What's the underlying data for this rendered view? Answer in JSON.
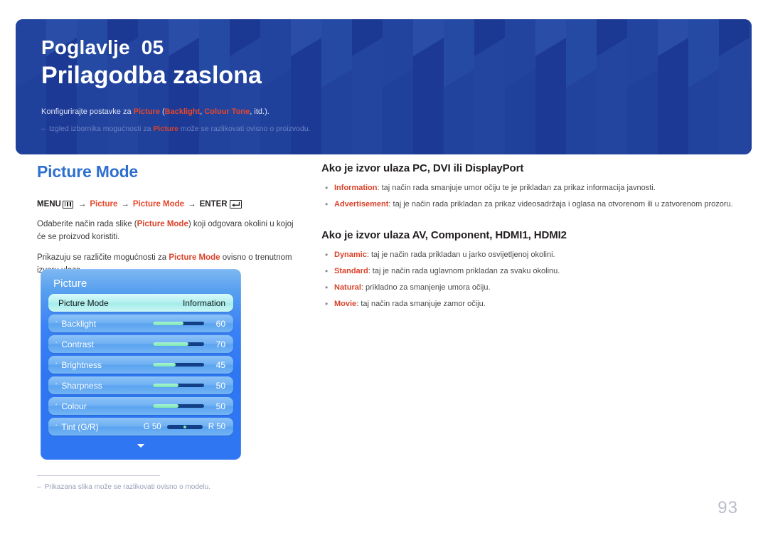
{
  "banner": {
    "chapter_label": "Poglavlje  05",
    "chapter_title": "Prilagodba zaslona",
    "desc_prefix": "Konfigurirajte postavke za ",
    "desc_kw1": "Picture",
    "desc_mid1": " (",
    "desc_kw2": "Backlight",
    "desc_mid2": ", ",
    "desc_kw3": "Colour Tone",
    "desc_suffix": ", itd.).",
    "note_dash": "–",
    "note_prefix": "Izgled izbornika mogućnosti za ",
    "note_kw": "Picture",
    "note_suffix": " može se razlikovati ovisno o proizvodu.",
    "bg_color": "#1f3f9e"
  },
  "left": {
    "section_heading": "Picture Mode",
    "section_heading_color": "#2f6fd0",
    "menu_path": {
      "menu_label": "MENU",
      "menu_icon": "menu-bars-icon",
      "arrow": "→",
      "step1": "Picture",
      "step2": "Picture Mode",
      "enter_label": "ENTER",
      "enter_icon": "enter-key-icon"
    },
    "paragraphs": [
      {
        "pre": "Odaberite način rada slike (",
        "kw": "Picture Mode",
        "post": ") koji odgovara okolini u kojoj će se proizvod koristiti."
      },
      {
        "pre": "Prikazuju se različite mogućnosti za ",
        "kw": "Picture Mode",
        "post": " ovisno o trenutnom izvoru ulaza."
      }
    ],
    "footnote": {
      "dash": "–",
      "text": "Prikazana slika može se razlikovati ovisno o modelu."
    }
  },
  "osd": {
    "title": "Picture",
    "rows": [
      {
        "label": "Picture Mode",
        "value": "Information",
        "type": "selected",
        "bullet": ""
      },
      {
        "label": "Backlight",
        "value": "60",
        "type": "slider",
        "bullet": "·",
        "fill_pct": 60
      },
      {
        "label": "Contrast",
        "value": "70",
        "type": "slider",
        "bullet": "·",
        "fill_pct": 70
      },
      {
        "label": "Brightness",
        "value": "45",
        "type": "slider",
        "bullet": "·",
        "fill_pct": 45
      },
      {
        "label": "Sharpness",
        "value": "50",
        "type": "slider",
        "bullet": "·",
        "fill_pct": 50
      },
      {
        "label": "Colour",
        "value": "50",
        "type": "slider",
        "bullet": "·",
        "fill_pct": 50
      },
      {
        "label": "Tint (G/R)",
        "value": "",
        "type": "tint",
        "bullet": "·",
        "tint_left": "G 50",
        "tint_right": "R 50"
      }
    ],
    "more_indicator": "chevron-down-icon"
  },
  "right": {
    "section1": {
      "heading": "Ako je izvor ulaza PC, DVI ili DisplayPort",
      "items": [
        {
          "bullet": "•",
          "term": "Information",
          "desc": ": taj način rada smanjuje umor očiju te je prikladan za prikaz informacija javnosti."
        },
        {
          "bullet": "•",
          "term": "Advertisement",
          "desc": ": taj je način rada prikladan za prikaz videosadržaja i oglasa na otvorenom ili u zatvorenom prozoru."
        }
      ]
    },
    "section2": {
      "heading": "Ako je izvor ulaza AV, Component, HDMI1, HDMI2",
      "items": [
        {
          "bullet": "•",
          "term": "Dynamic",
          "desc": ": taj je način rada prikladan u jarko osvijetljenoj okolini."
        },
        {
          "bullet": "•",
          "term": "Standard",
          "desc": ": taj je način rada uglavnom prikladan za svaku okolinu."
        },
        {
          "bullet": "•",
          "term": "Natural",
          "desc": ": prikladno za smanjenje umora očiju."
        },
        {
          "bullet": "•",
          "term": "Movie",
          "desc": ": taj način rada smanjuje zamor očiju."
        }
      ]
    }
  },
  "page_number": "93",
  "accent_colors": {
    "keyword_red": "#d9422a",
    "heading_blue": "#2f6fd0",
    "banner_blue": "#1f3f9e",
    "osd_blue": "#2f77f2",
    "slider_green": "#7de8b5"
  }
}
